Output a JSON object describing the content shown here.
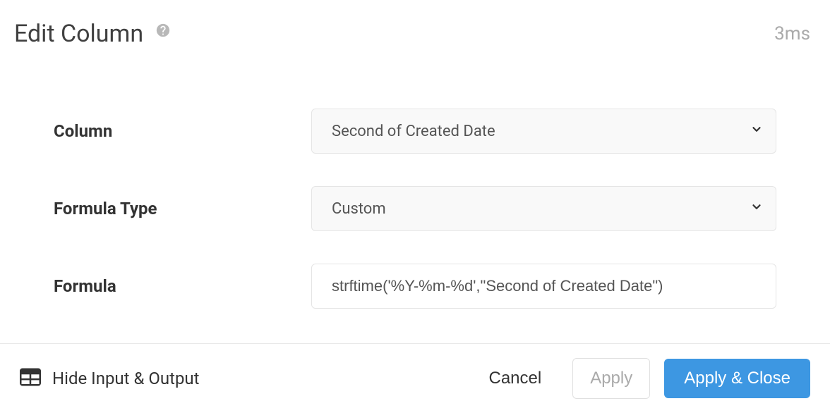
{
  "header": {
    "title": "Edit Column",
    "timing": "3ms"
  },
  "form": {
    "column": {
      "label": "Column",
      "value": "Second of Created Date"
    },
    "formula_type": {
      "label": "Formula Type",
      "value": "Custom"
    },
    "formula": {
      "label": "Formula",
      "value": "strftime('%Y-%m-%d',\"Second of Created Date\")"
    }
  },
  "footer": {
    "toggle_label": "Hide Input & Output",
    "cancel": "Cancel",
    "apply": "Apply",
    "apply_close": "Apply & Close"
  }
}
